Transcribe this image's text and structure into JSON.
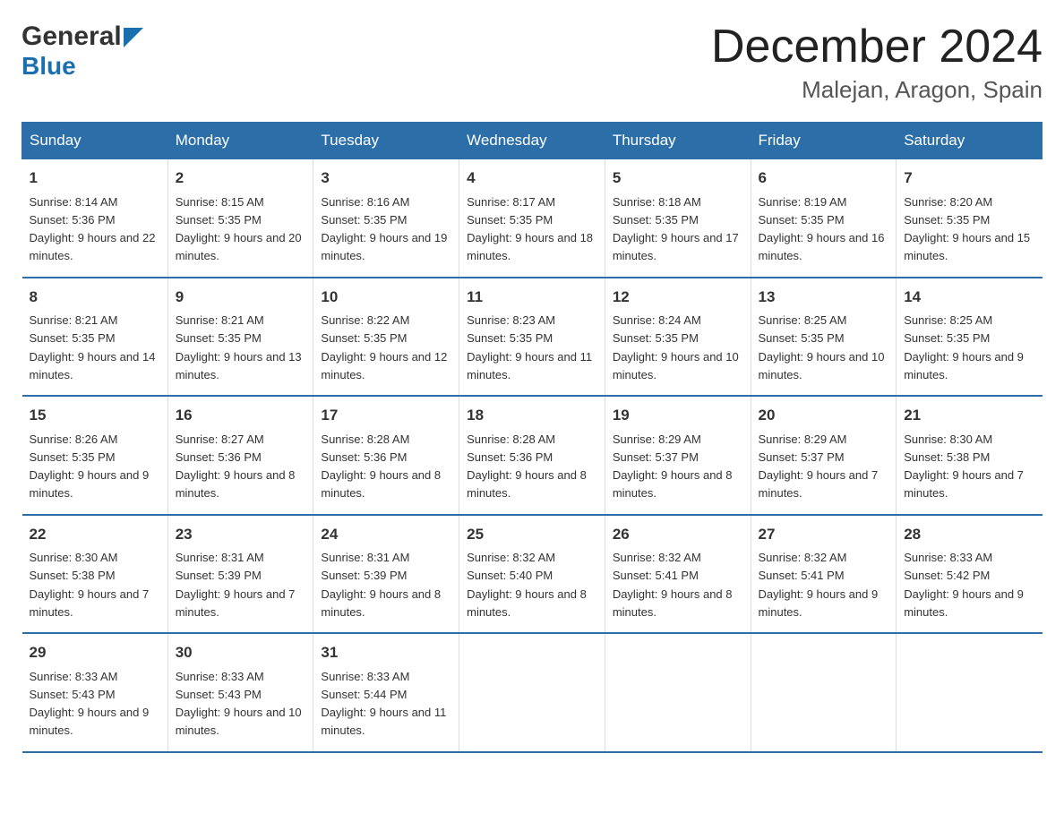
{
  "header": {
    "logo_general": "General",
    "logo_blue": "Blue",
    "month_title": "December 2024",
    "location": "Malejan, Aragon, Spain"
  },
  "days_of_week": [
    "Sunday",
    "Monday",
    "Tuesday",
    "Wednesday",
    "Thursday",
    "Friday",
    "Saturday"
  ],
  "weeks": [
    [
      {
        "day": "1",
        "sunrise": "8:14 AM",
        "sunset": "5:36 PM",
        "daylight": "9 hours and 22 minutes."
      },
      {
        "day": "2",
        "sunrise": "8:15 AM",
        "sunset": "5:35 PM",
        "daylight": "9 hours and 20 minutes."
      },
      {
        "day": "3",
        "sunrise": "8:16 AM",
        "sunset": "5:35 PM",
        "daylight": "9 hours and 19 minutes."
      },
      {
        "day": "4",
        "sunrise": "8:17 AM",
        "sunset": "5:35 PM",
        "daylight": "9 hours and 18 minutes."
      },
      {
        "day": "5",
        "sunrise": "8:18 AM",
        "sunset": "5:35 PM",
        "daylight": "9 hours and 17 minutes."
      },
      {
        "day": "6",
        "sunrise": "8:19 AM",
        "sunset": "5:35 PM",
        "daylight": "9 hours and 16 minutes."
      },
      {
        "day": "7",
        "sunrise": "8:20 AM",
        "sunset": "5:35 PM",
        "daylight": "9 hours and 15 minutes."
      }
    ],
    [
      {
        "day": "8",
        "sunrise": "8:21 AM",
        "sunset": "5:35 PM",
        "daylight": "9 hours and 14 minutes."
      },
      {
        "day": "9",
        "sunrise": "8:21 AM",
        "sunset": "5:35 PM",
        "daylight": "9 hours and 13 minutes."
      },
      {
        "day": "10",
        "sunrise": "8:22 AM",
        "sunset": "5:35 PM",
        "daylight": "9 hours and 12 minutes."
      },
      {
        "day": "11",
        "sunrise": "8:23 AM",
        "sunset": "5:35 PM",
        "daylight": "9 hours and 11 minutes."
      },
      {
        "day": "12",
        "sunrise": "8:24 AM",
        "sunset": "5:35 PM",
        "daylight": "9 hours and 10 minutes."
      },
      {
        "day": "13",
        "sunrise": "8:25 AM",
        "sunset": "5:35 PM",
        "daylight": "9 hours and 10 minutes."
      },
      {
        "day": "14",
        "sunrise": "8:25 AM",
        "sunset": "5:35 PM",
        "daylight": "9 hours and 9 minutes."
      }
    ],
    [
      {
        "day": "15",
        "sunrise": "8:26 AM",
        "sunset": "5:35 PM",
        "daylight": "9 hours and 9 minutes."
      },
      {
        "day": "16",
        "sunrise": "8:27 AM",
        "sunset": "5:36 PM",
        "daylight": "9 hours and 8 minutes."
      },
      {
        "day": "17",
        "sunrise": "8:28 AM",
        "sunset": "5:36 PM",
        "daylight": "9 hours and 8 minutes."
      },
      {
        "day": "18",
        "sunrise": "8:28 AM",
        "sunset": "5:36 PM",
        "daylight": "9 hours and 8 minutes."
      },
      {
        "day": "19",
        "sunrise": "8:29 AM",
        "sunset": "5:37 PM",
        "daylight": "9 hours and 8 minutes."
      },
      {
        "day": "20",
        "sunrise": "8:29 AM",
        "sunset": "5:37 PM",
        "daylight": "9 hours and 7 minutes."
      },
      {
        "day": "21",
        "sunrise": "8:30 AM",
        "sunset": "5:38 PM",
        "daylight": "9 hours and 7 minutes."
      }
    ],
    [
      {
        "day": "22",
        "sunrise": "8:30 AM",
        "sunset": "5:38 PM",
        "daylight": "9 hours and 7 minutes."
      },
      {
        "day": "23",
        "sunrise": "8:31 AM",
        "sunset": "5:39 PM",
        "daylight": "9 hours and 7 minutes."
      },
      {
        "day": "24",
        "sunrise": "8:31 AM",
        "sunset": "5:39 PM",
        "daylight": "9 hours and 8 minutes."
      },
      {
        "day": "25",
        "sunrise": "8:32 AM",
        "sunset": "5:40 PM",
        "daylight": "9 hours and 8 minutes."
      },
      {
        "day": "26",
        "sunrise": "8:32 AM",
        "sunset": "5:41 PM",
        "daylight": "9 hours and 8 minutes."
      },
      {
        "day": "27",
        "sunrise": "8:32 AM",
        "sunset": "5:41 PM",
        "daylight": "9 hours and 9 minutes."
      },
      {
        "day": "28",
        "sunrise": "8:33 AM",
        "sunset": "5:42 PM",
        "daylight": "9 hours and 9 minutes."
      }
    ],
    [
      {
        "day": "29",
        "sunrise": "8:33 AM",
        "sunset": "5:43 PM",
        "daylight": "9 hours and 9 minutes."
      },
      {
        "day": "30",
        "sunrise": "8:33 AM",
        "sunset": "5:43 PM",
        "daylight": "9 hours and 10 minutes."
      },
      {
        "day": "31",
        "sunrise": "8:33 AM",
        "sunset": "5:44 PM",
        "daylight": "9 hours and 11 minutes."
      },
      null,
      null,
      null,
      null
    ]
  ],
  "labels": {
    "sunrise_prefix": "Sunrise: ",
    "sunset_prefix": "Sunset: ",
    "daylight_prefix": "Daylight: "
  }
}
